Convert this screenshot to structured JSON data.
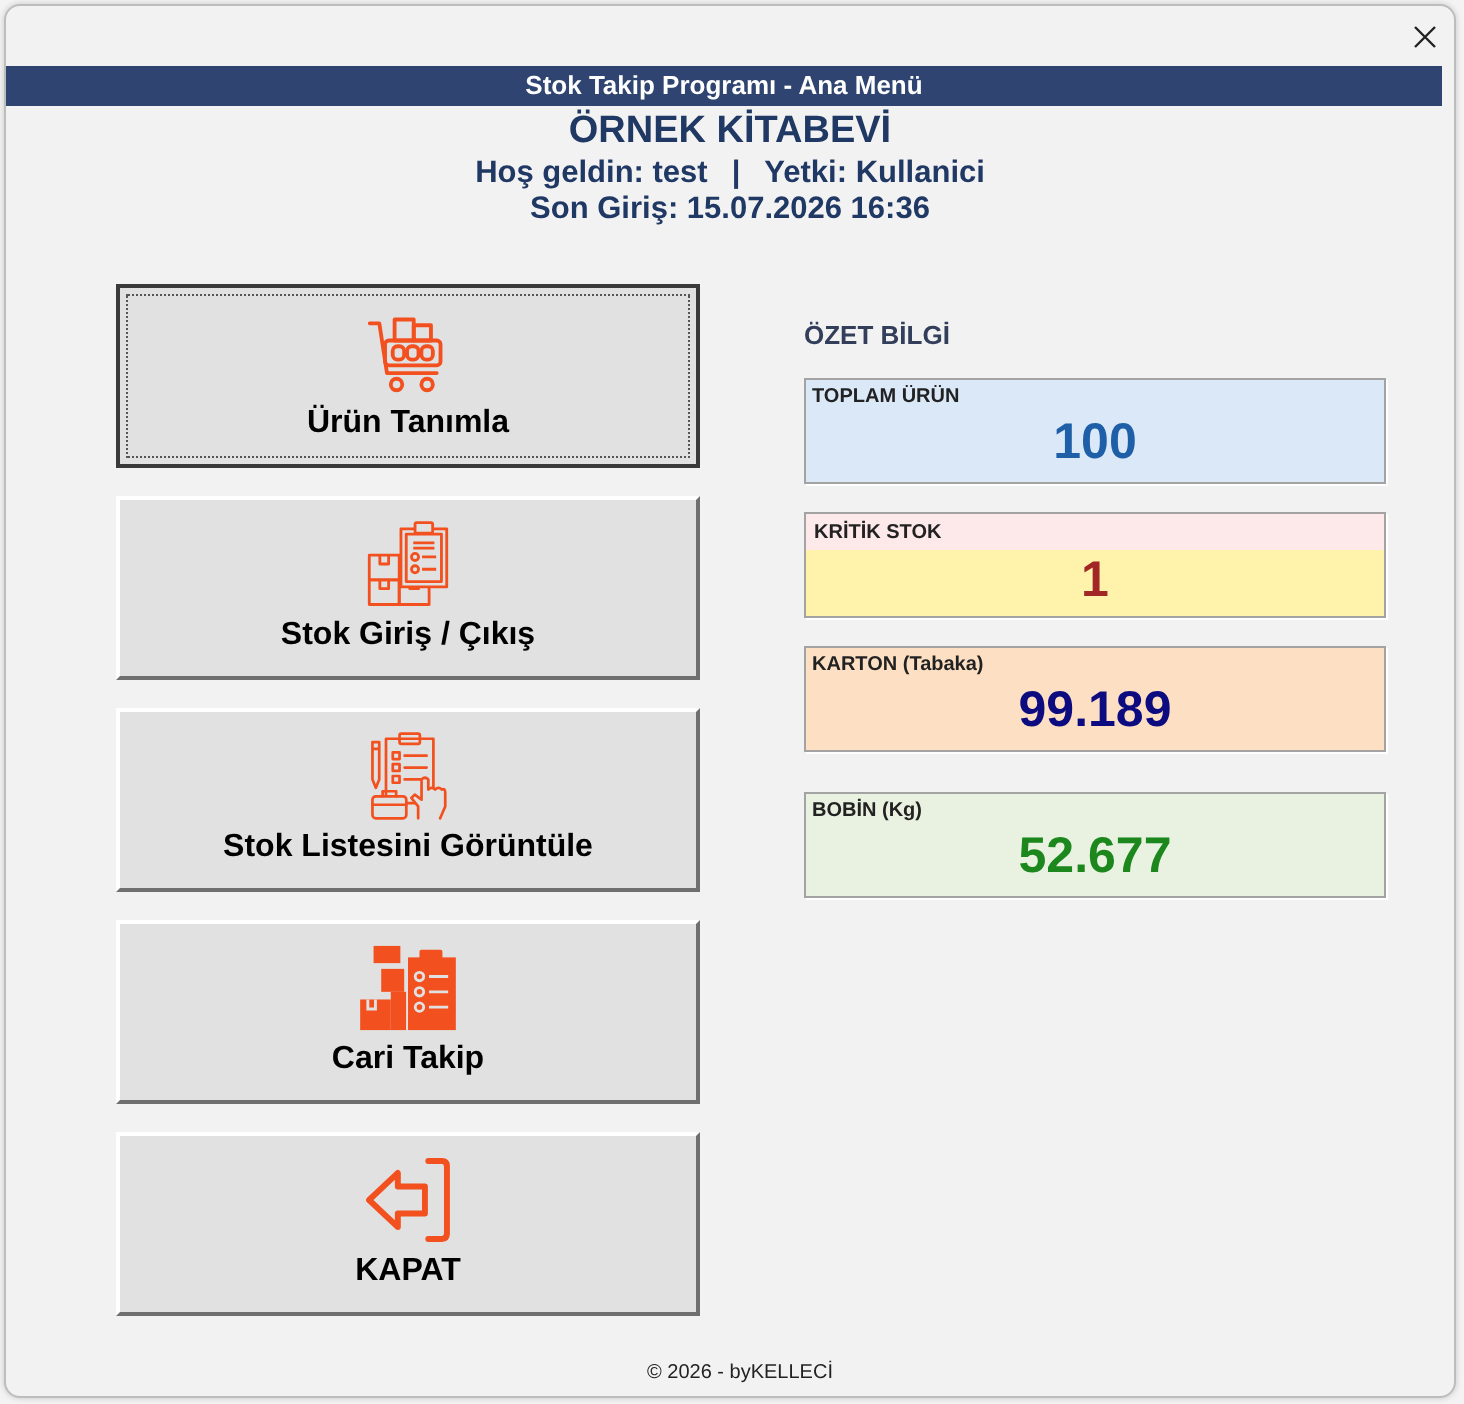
{
  "window": {
    "title": "Stok Takip Programı - Ana Menü"
  },
  "header": {
    "company": "ÖRNEK KİTABEVİ",
    "welcome": "Hoş geldin: test",
    "separator": "|",
    "role": "Yetki: Kullanici",
    "last_login": "Son Giriş: 15.07.2026 16:36"
  },
  "menu_buttons": [
    {
      "label": "Ürün Tanımla",
      "focused": true
    },
    {
      "label": "Stok Giriş / Çıkış",
      "focused": false
    },
    {
      "label": "Stok Listesini Görüntüle",
      "focused": false
    },
    {
      "label": "Cari Takip",
      "focused": false
    },
    {
      "label": "KAPAT",
      "focused": false
    }
  ],
  "summary": {
    "title": "ÖZET BİLGİ",
    "cards": [
      {
        "kind": "total",
        "label": "TOPLAM ÜRÜN",
        "value": "100",
        "color": "#dae8f8"
      },
      {
        "kind": "critical",
        "label": "KRİTİK STOK",
        "value": "1",
        "color": "#fff2ab"
      },
      {
        "kind": "carton",
        "label": "KARTON (Tabaka)",
        "value": "99.189",
        "color": "#fde0c4"
      },
      {
        "kind": "coil",
        "label": "BOBİN (Kg)",
        "value": "52.677",
        "color": "#e9f2e1"
      }
    ]
  },
  "footer": "© 2026 - byKELLECİ"
}
